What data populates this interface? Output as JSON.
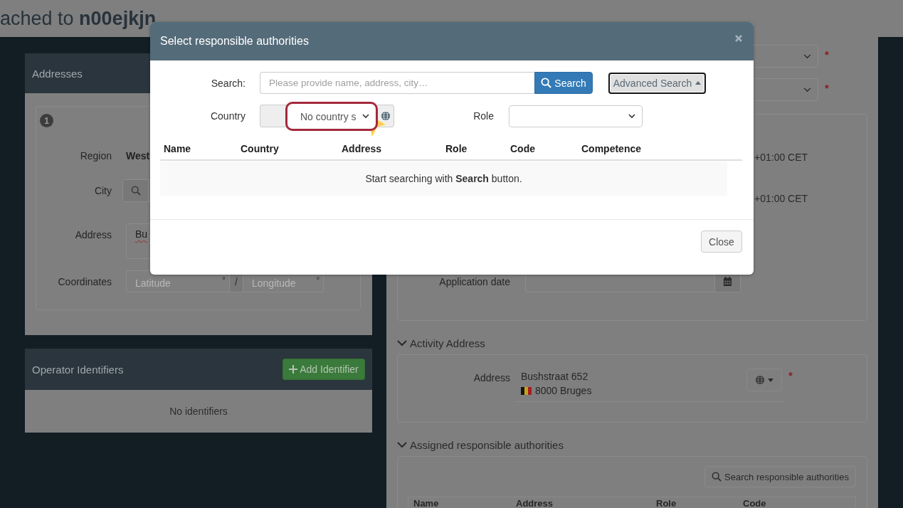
{
  "page_header": {
    "title": "ached to **n00ejkjn**"
  },
  "addresses_panel": {
    "title": "Addresses",
    "badge": "1",
    "fields": [
      {
        "kind": "text",
        "label": "Region",
        "value": "West"
      },
      {
        "kind": "search",
        "label": "City"
      },
      {
        "kind": "textarea",
        "label": "Address",
        "value": "Bu",
        "misspelled": true
      },
      {
        "kind": "coordinates",
        "label": "Coordinates",
        "latitude_placeholder": "Latitude",
        "latitude_unit": "°",
        "separator": "/",
        "longitude_placeholder": "Longitude",
        "longitude_unit": "°"
      }
    ]
  },
  "identifiers_panel": {
    "title": "Operator Identifiers",
    "add_button": "Add Identifier",
    "empty_text": "No identifiers"
  },
  "details": {
    "selects": [
      {
        "required_mark": "*"
      },
      {
        "required_mark": "*"
      }
    ],
    "timezones": [
      "+01:00 CET",
      "+01:00 CET"
    ],
    "application_date": {
      "label": "Application date"
    }
  },
  "activity_address": {
    "heading": "Activity Address",
    "expanded": true,
    "label": "Address",
    "street": "Bushstraat 652",
    "city": "8000 Bruges",
    "required_mark": "*"
  },
  "assigned_authorities": {
    "heading": "Assigned responsible authorities",
    "expanded": true,
    "search_button": "Search responsible authorities",
    "columns": [
      "Name",
      "Address",
      "Role",
      "Code"
    ]
  },
  "modal": {
    "title": "Select responsible authorities",
    "search": {
      "label": "Search:",
      "placeholder": "Please provide name, address, city…",
      "button": "Search"
    },
    "advanced_search": {
      "label": "Advanced Search",
      "expanded": true,
      "focused": true
    },
    "country": {
      "label": "Country",
      "value": "No country s",
      "highlighted": true
    },
    "role": {
      "label": "Role"
    },
    "results": {
      "columns": [
        "Name",
        "Country",
        "Address",
        "Role",
        "Code",
        "Competence"
      ],
      "empty_text": "Start searching with **Search** button."
    },
    "close_button": "Close"
  }
}
